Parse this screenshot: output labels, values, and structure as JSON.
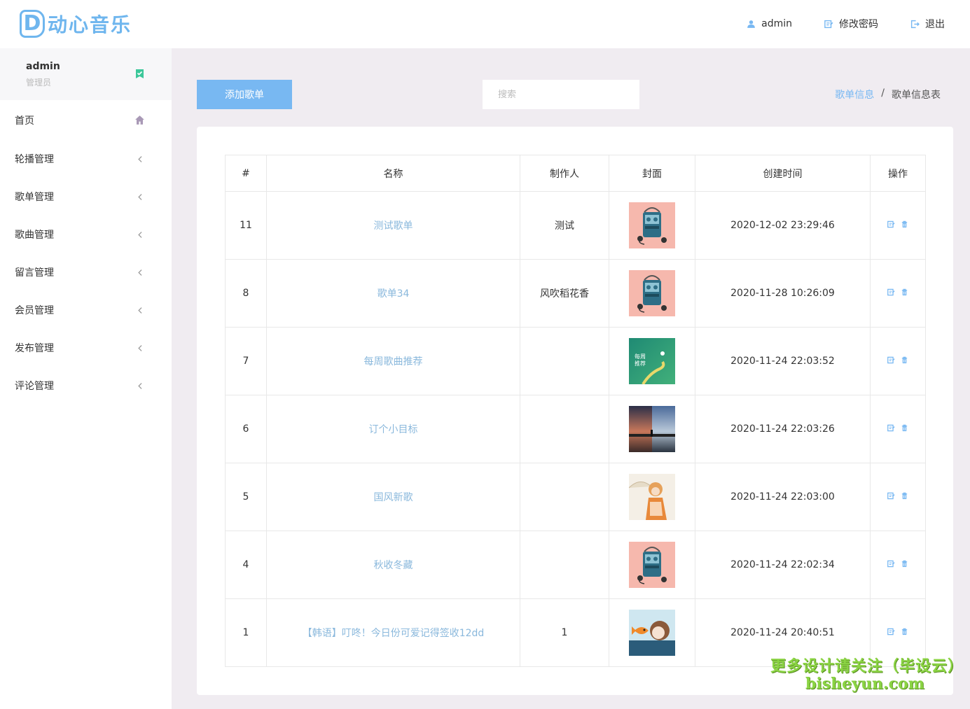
{
  "app": {
    "logo_letter": "D",
    "logo_text": "动心音乐"
  },
  "header": {
    "user": "admin",
    "change_password": "修改密码",
    "logout": "退出"
  },
  "sidebar": {
    "user_name": "admin",
    "user_role": "管理员",
    "items": [
      {
        "label": "首页",
        "icon": "home-icon"
      },
      {
        "label": "轮播管理",
        "icon": "chevron-left-icon"
      },
      {
        "label": "歌单管理",
        "icon": "chevron-left-icon"
      },
      {
        "label": "歌曲管理",
        "icon": "chevron-left-icon"
      },
      {
        "label": "留言管理",
        "icon": "chevron-left-icon"
      },
      {
        "label": "会员管理",
        "icon": "chevron-left-icon"
      },
      {
        "label": "发布管理",
        "icon": "chevron-left-icon"
      },
      {
        "label": "评论管理",
        "icon": "chevron-left-icon"
      }
    ]
  },
  "toolbar": {
    "add_label": "添加歌单",
    "search_placeholder": "搜索",
    "breadcrumb_parent": "歌单信息",
    "breadcrumb_sep": "/",
    "breadcrumb_current": "歌单信息表"
  },
  "table": {
    "headers": [
      "#",
      "名称",
      "制作人",
      "封面",
      "创建时间",
      "操作"
    ],
    "rows": [
      {
        "id": "11",
        "name": "测试歌单",
        "creator": "测试",
        "cover": "cassette-player",
        "created": "2020-12-02 23:29:46"
      },
      {
        "id": "8",
        "name": "歌单34",
        "creator": "风吹稻花香",
        "cover": "cassette-player",
        "created": "2020-11-28 10:26:09"
      },
      {
        "id": "7",
        "name": "每周歌曲推荐",
        "creator": "",
        "cover": "weekly-green",
        "created": "2020-11-24 22:03:52"
      },
      {
        "id": "6",
        "name": "订个小目标",
        "creator": "",
        "cover": "sunset-landscape",
        "created": "2020-11-24 22:03:26"
      },
      {
        "id": "5",
        "name": "国风新歌",
        "creator": "",
        "cover": "girl-umbrella",
        "created": "2020-11-24 22:03:00"
      },
      {
        "id": "4",
        "name": "秋收冬藏",
        "creator": "",
        "cover": "cassette-player",
        "created": "2020-11-24 22:02:34"
      },
      {
        "id": "1",
        "name": "【韩语】叮咚！今日份可爱记得签收12dd",
        "creator": "1",
        "cover": "girl-fish",
        "created": "2020-11-24 20:40:51"
      }
    ],
    "cover_text_weekly": "每周推荐"
  },
  "watermark": {
    "line1": "更多设计请关注（毕设云）",
    "line2": "bisheyun.com"
  },
  "colors": {
    "accent": "#78b8f2",
    "link": "#8ab8dc",
    "page_bg": "#f0ecf1"
  }
}
